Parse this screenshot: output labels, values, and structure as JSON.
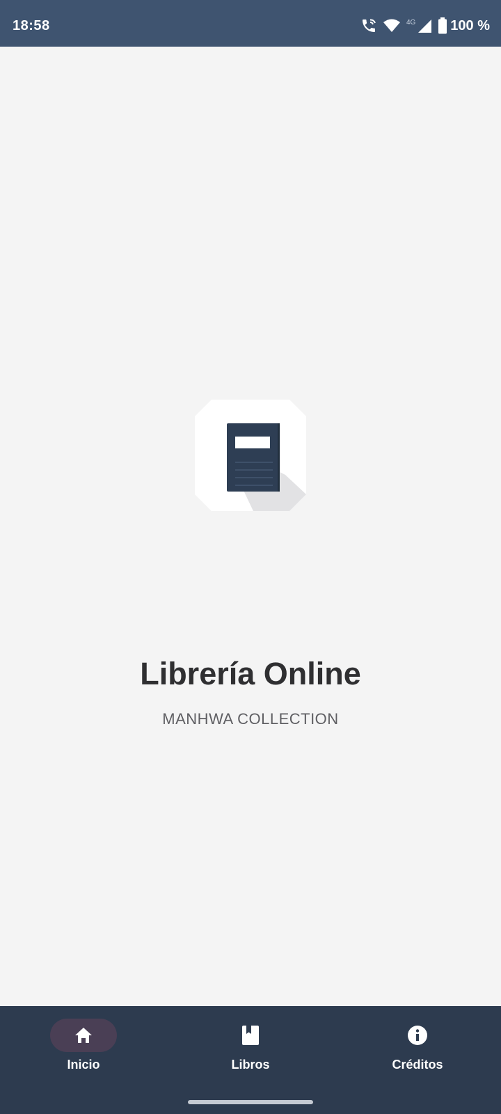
{
  "status_bar": {
    "time": "18:58",
    "network_type": "4G",
    "battery": "100 %",
    "icons": [
      "wifi-calling-icon",
      "wifi-icon",
      "signal-icon",
      "battery-icon"
    ]
  },
  "app": {
    "title": "Librería Online",
    "subtitle": "MANHWA COLLECTION",
    "logo_icon": "book-icon"
  },
  "bottom_nav": {
    "items": [
      {
        "label": "Inicio",
        "icon": "home-icon",
        "active": true
      },
      {
        "label": "Libros",
        "icon": "book-bookmark-icon",
        "active": false
      },
      {
        "label": "Créditos",
        "icon": "info-icon",
        "active": false
      }
    ]
  },
  "colors": {
    "status_bar": "#3f5470",
    "background": "#f4f4f4",
    "nav_background": "#2d3b4f",
    "active_pill": "#4a3f55",
    "book_cover": "#2e3e54",
    "title_text": "#2f2f31"
  }
}
